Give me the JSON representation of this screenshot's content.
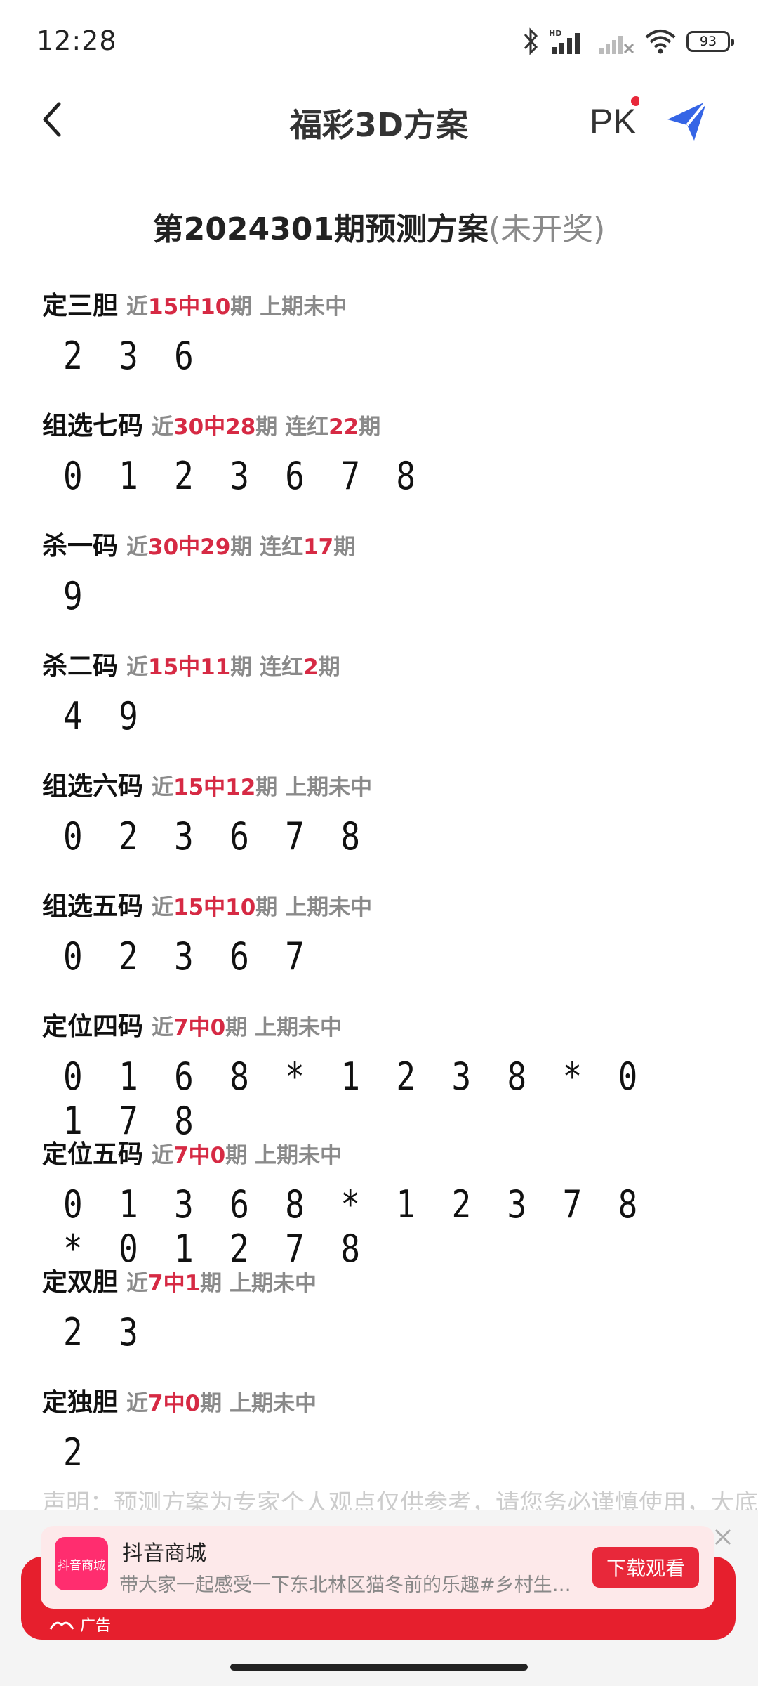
{
  "status_bar": {
    "time": "12:28",
    "battery": "93"
  },
  "nav": {
    "title": "福彩3D方案",
    "pk_label": "PK"
  },
  "heading": {
    "main": "第2024301期预测方案",
    "sub": "(未开奖)"
  },
  "sections": [
    {
      "label": "定三胆",
      "s1": "近",
      "s2": "15中10",
      "s3": "期 上期未中",
      "s4": "",
      "s5": "",
      "numbers": "2 3 6"
    },
    {
      "label": "组选七码",
      "s1": "近",
      "s2": "30中28",
      "s3": "期 连红",
      "s4": "22",
      "s5": "期",
      "numbers": "0 1 2 3 6 7 8"
    },
    {
      "label": "杀一码",
      "s1": "近",
      "s2": "30中29",
      "s3": "期 连红",
      "s4": "17",
      "s5": "期",
      "numbers": "9"
    },
    {
      "label": "杀二码",
      "s1": "近",
      "s2": "15中11",
      "s3": "期 连红",
      "s4": "2",
      "s5": "期",
      "numbers": "4 9"
    },
    {
      "label": "组选六码",
      "s1": "近",
      "s2": "15中12",
      "s3": "期 上期未中",
      "s4": "",
      "s5": "",
      "numbers": "0 2 3 6 7 8"
    },
    {
      "label": "组选五码",
      "s1": "近",
      "s2": "15中10",
      "s3": "期 上期未中",
      "s4": "",
      "s5": "",
      "numbers": "0 2 3 6 7"
    },
    {
      "label": "定位四码",
      "s1": "近",
      "s2": "7中0",
      "s3": "期 上期未中",
      "s4": "",
      "s5": "",
      "numbers": "0 1 6 8 * 1 2 3 8 * 0 1 7 8"
    },
    {
      "label": "定位五码",
      "s1": "近",
      "s2": "7中0",
      "s3": "期 上期未中",
      "s4": "",
      "s5": "",
      "numbers": "0 1 3 6 8 * 1 2 3 7 8 * 0 1 2 7 8"
    },
    {
      "label": "定双胆",
      "s1": "近",
      "s2": "7中1",
      "s3": "期 上期未中",
      "s4": "",
      "s5": "",
      "numbers": "2 3"
    },
    {
      "label": "定独胆",
      "s1": "近",
      "s2": "7中0",
      "s3": "期 上期未中",
      "s4": "",
      "s5": "",
      "numbers": "2"
    }
  ],
  "disclaimer": "声明：预测方案为专家个人观点仅供参考，请您务必谨慎使用，大底",
  "ad": {
    "app_name": "抖音商城",
    "logo_text": "抖音商城",
    "description": "带大家一起感受一下东北林区猫冬前的乐趣#乡村生…",
    "button": "下载观看",
    "tag": "广告"
  }
}
